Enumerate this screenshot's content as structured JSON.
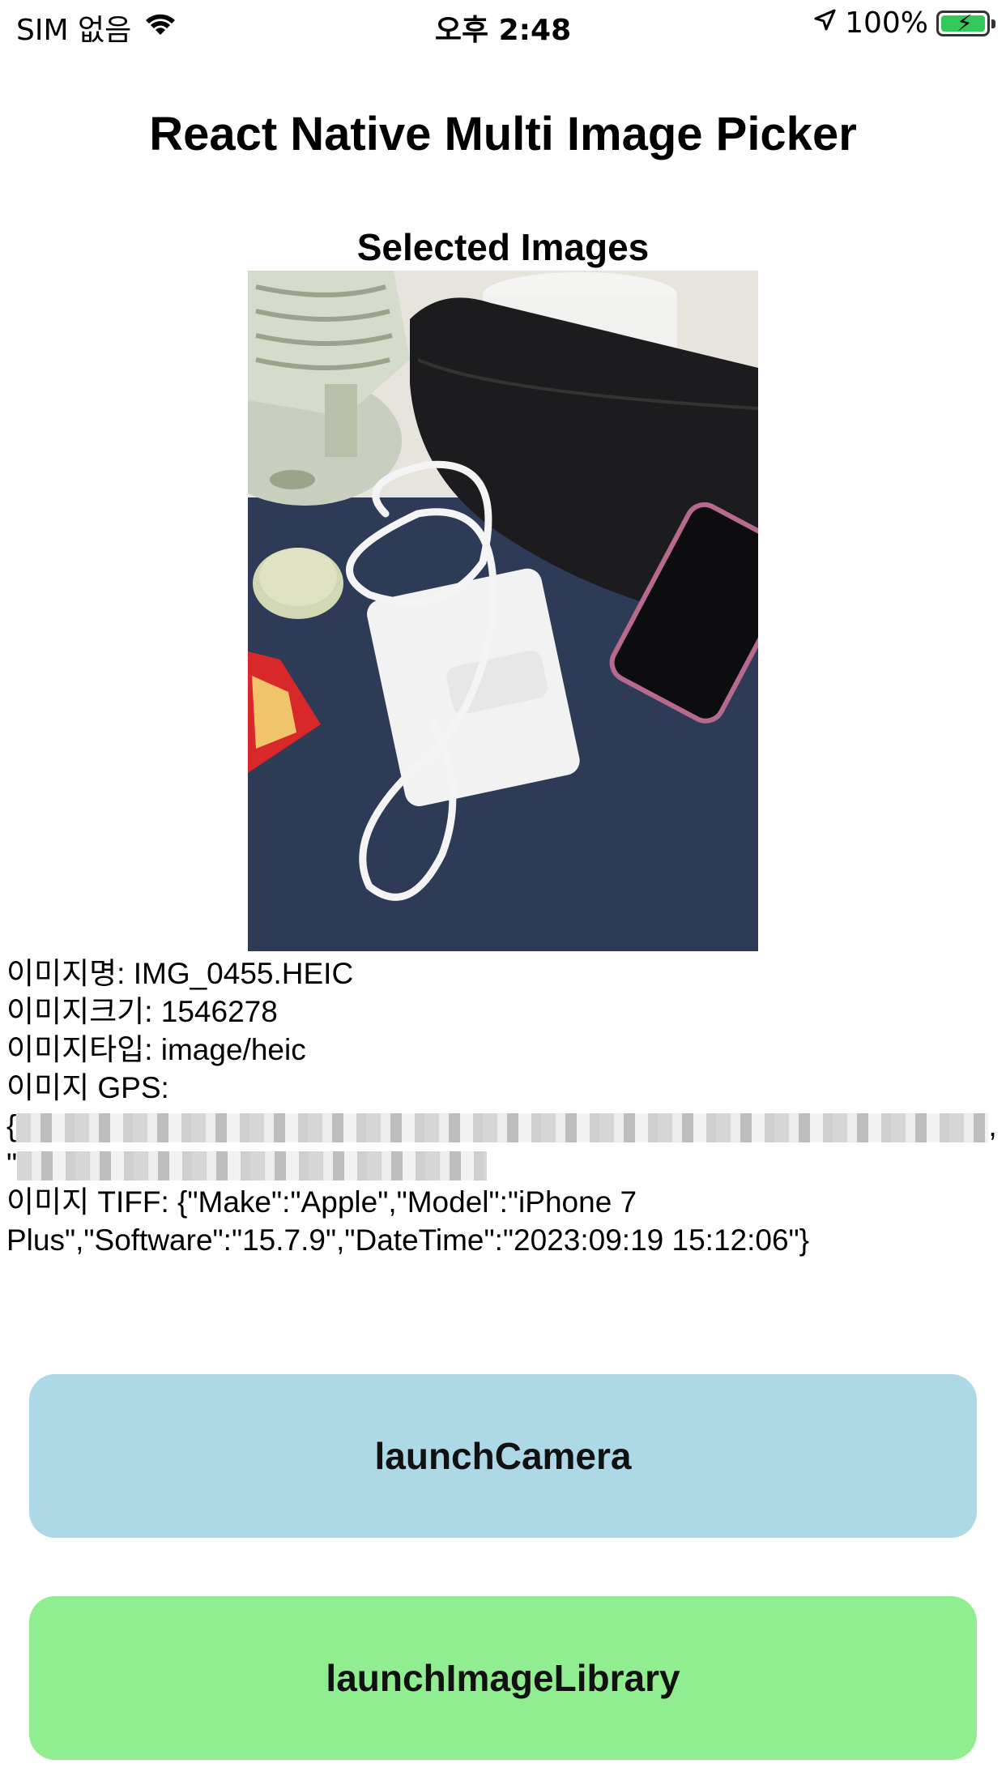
{
  "status_bar": {
    "carrier": "SIM 없음",
    "time": "오후 2:48",
    "battery": "100%",
    "icons": [
      "wifi-icon",
      "location-arrow-icon",
      "battery-charging-icon"
    ],
    "battery_color": "#34c759"
  },
  "header": {
    "title": "React Native Multi Image Picker",
    "subtitle": "Selected Images"
  },
  "image_info": {
    "name": "이미지명: IMG_0455.HEIC",
    "size": "이미지크기: 1546278",
    "type": "이미지타입: image/heic",
    "gps_label": "이미지 GPS:",
    "gps_open": "{",
    "gps_comma": ",",
    "gps_quote": "\"",
    "tiff": "이미지 TIFF: {\"Make\":\"Apple\",\"Model\":\"iPhone 7 Plus\",\"Software\":\"15.7.9\",\"DateTime\":\"2023:09:19 15:12:06\"}"
  },
  "buttons": {
    "camera": "launchCamera",
    "library": "launchImageLibrary",
    "camera_color": "#add8e6",
    "library_color": "#90ee90"
  }
}
